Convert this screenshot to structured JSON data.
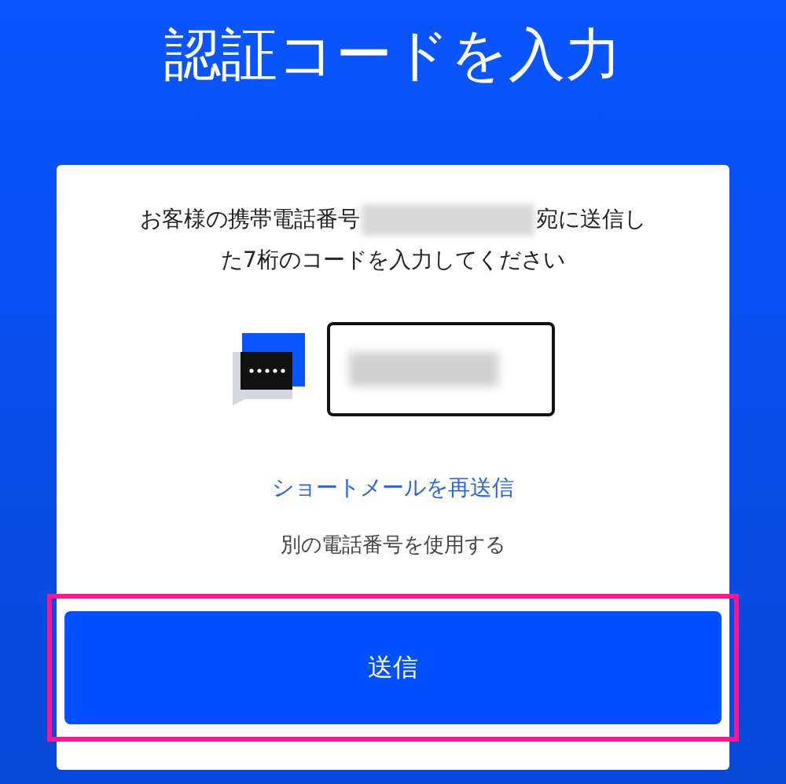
{
  "title": "認証コードを入力",
  "message": {
    "before": "お客様の携帯電話番号",
    "after": [
      "宛に送信し",
      "た7桁のコードを入力してください"
    ]
  },
  "code_field": {
    "redacted": true
  },
  "resend_link": "ショートメールを再送信",
  "other_number": "別の電話番号を使用する",
  "submit_button": {
    "label": "送信",
    "highlighted": true
  }
}
